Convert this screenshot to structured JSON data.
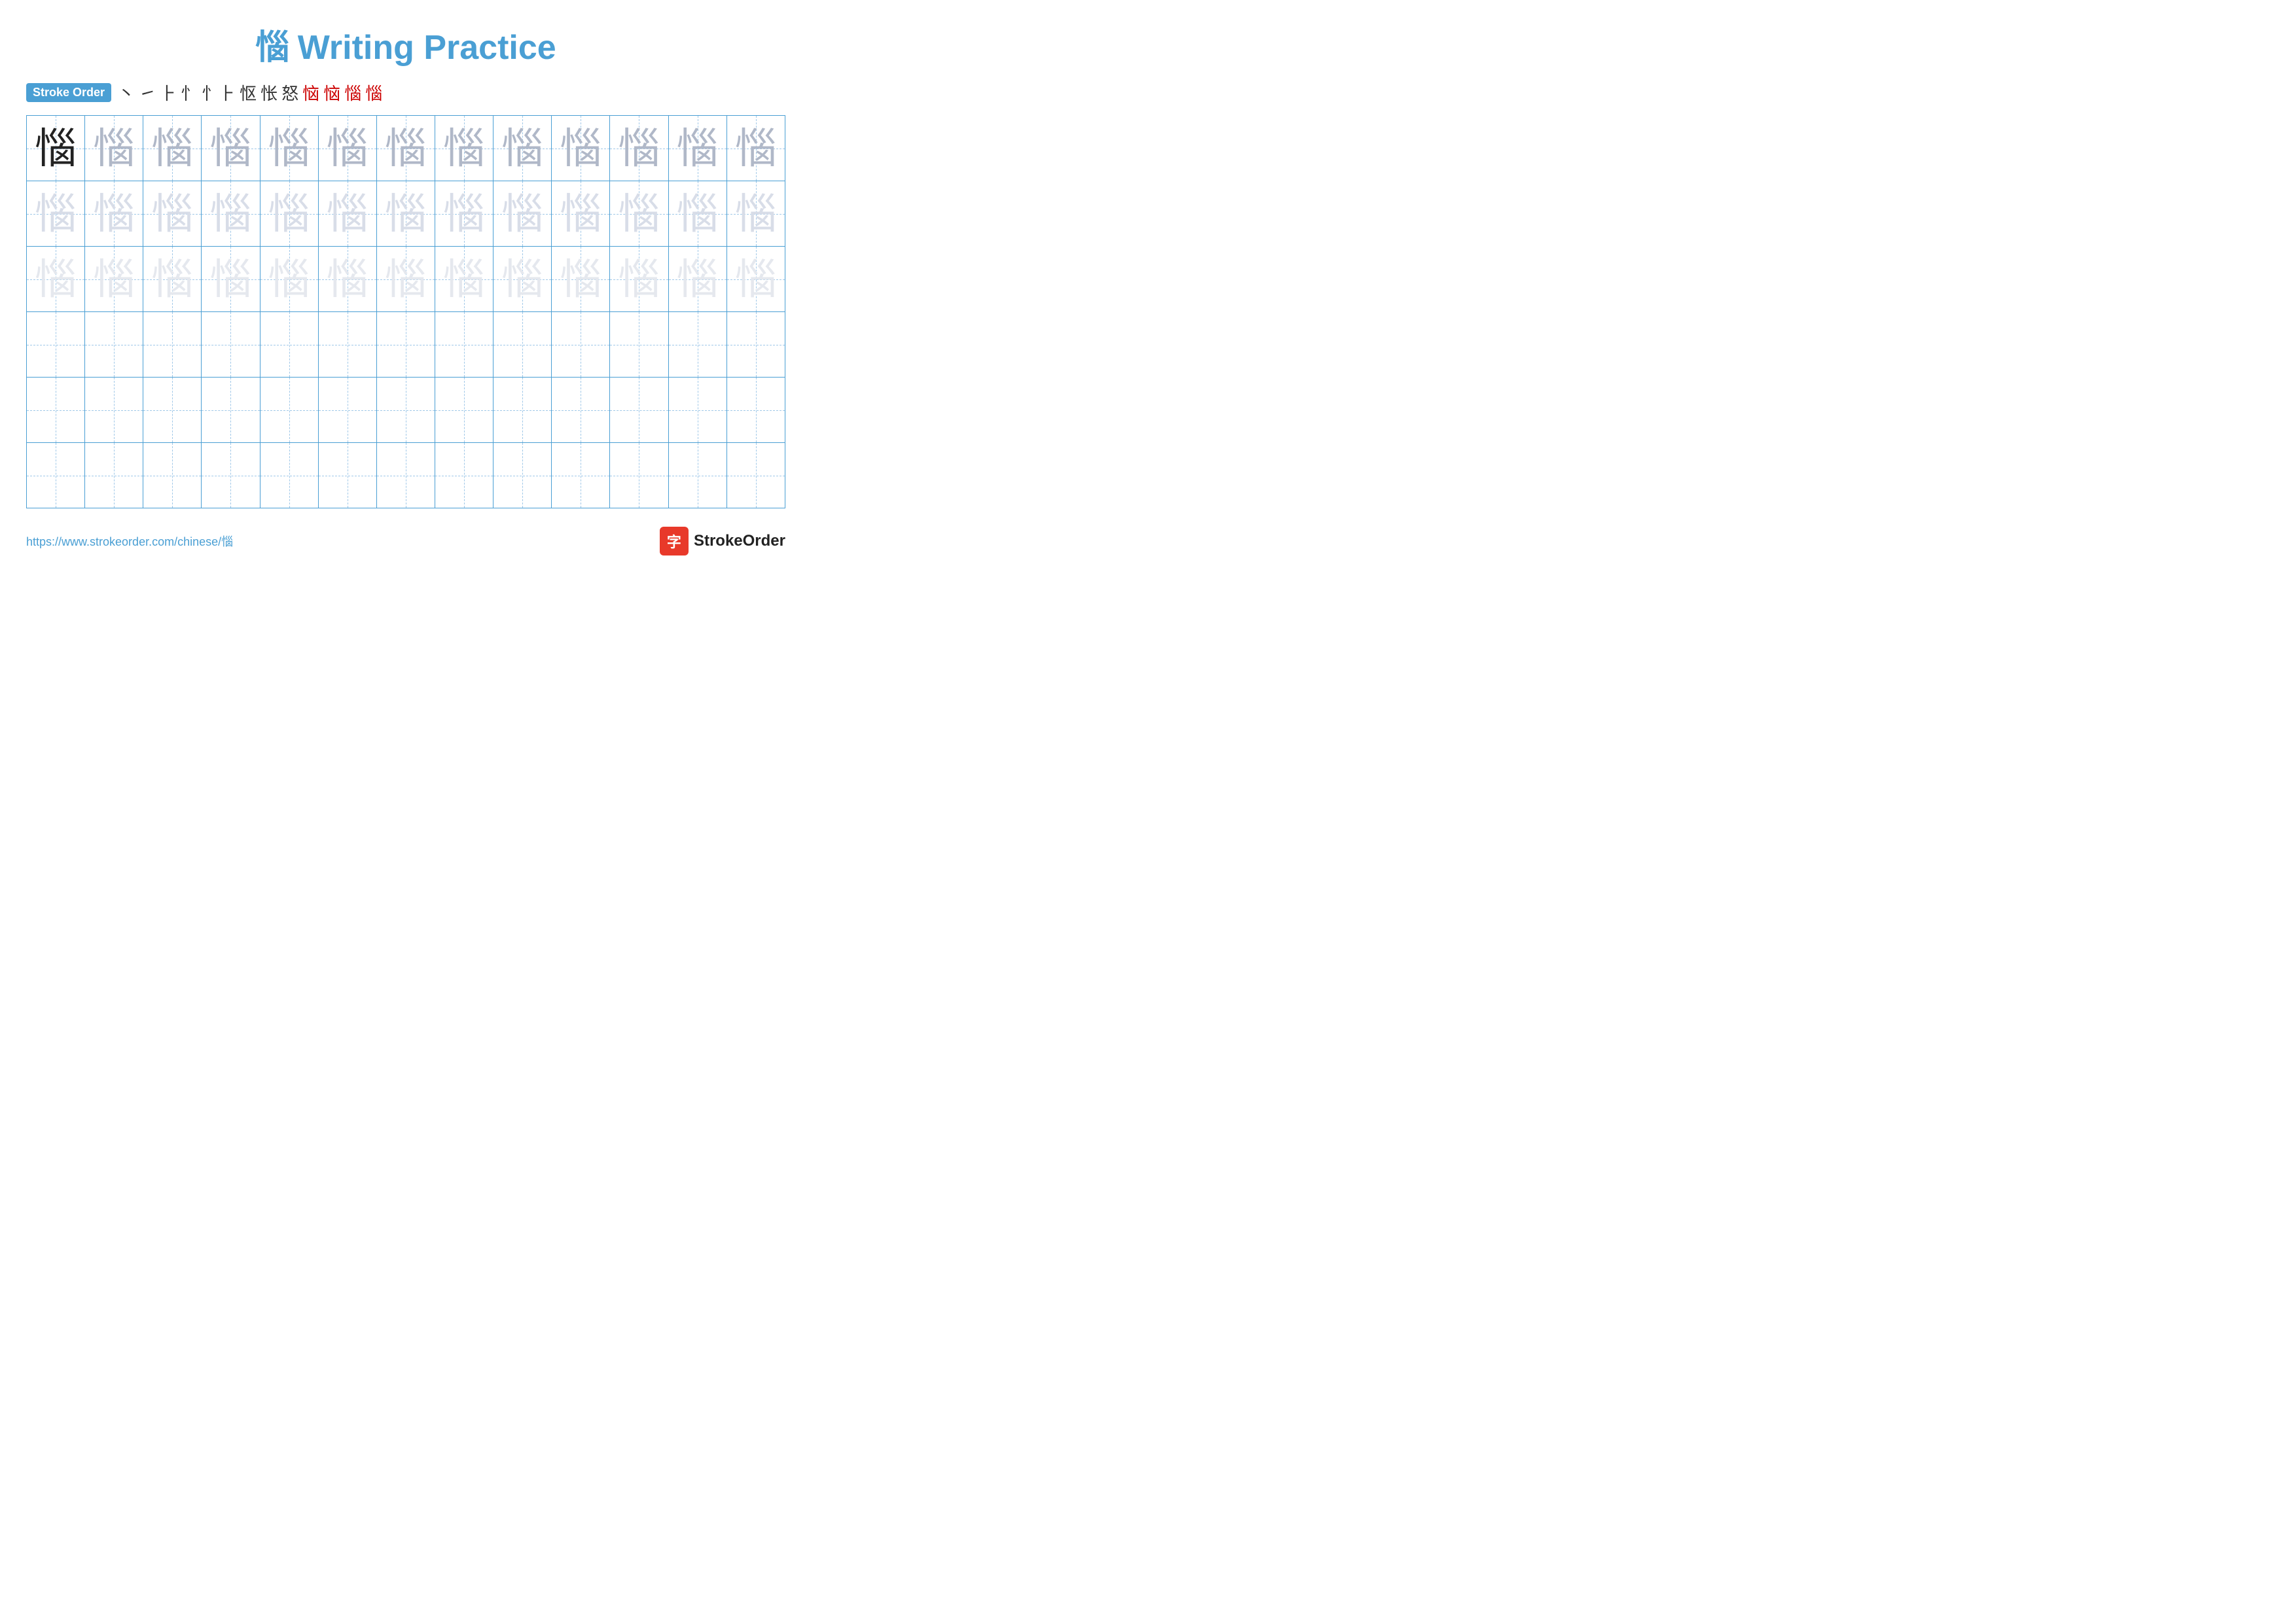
{
  "title": {
    "char": "惱",
    "text": "Writing Practice"
  },
  "stroke_order": {
    "badge_label": "Stroke Order",
    "steps": [
      "丶",
      "㇀",
      "⺊",
      "忄",
      "忄㇀",
      "忄㇀㇀",
      "忄㇀㇀丿",
      "忄㇀㇀丿㇀",
      "惱",
      "惱",
      "惱",
      "惱"
    ]
  },
  "practice_char": "惱",
  "footer": {
    "url": "https://www.strokeorder.com/chinese/惱",
    "brand_icon": "字",
    "brand_name": "StrokeOrder"
  }
}
